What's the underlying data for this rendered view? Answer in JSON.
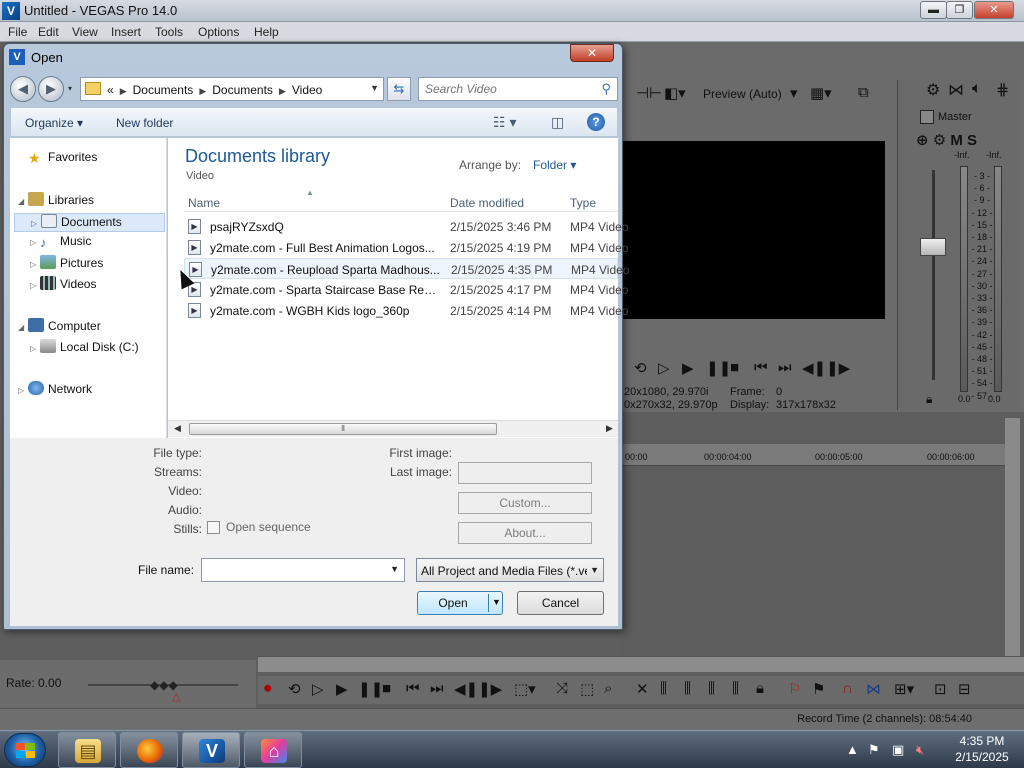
{
  "app": {
    "title": "Untitled - VEGAS Pro 14.0",
    "logo": "V",
    "window_controls": {
      "minimize": "▬",
      "maximize": "❐",
      "close": "✕"
    },
    "menu": [
      "File",
      "Edit",
      "View",
      "Insert",
      "Tools",
      "Options",
      "Help"
    ],
    "preview": {
      "mode_label": "Preview (Auto)",
      "info_line1": "20x1080, 29.970i",
      "info_line2": "0x270x32, 29.970p",
      "frame_label": "Frame:",
      "frame_value": "0",
      "display_label": "Display:",
      "display_value": "317x178x32"
    },
    "master": {
      "title": "Master",
      "inf_left": "-Inf.",
      "inf_right": "-Inf.",
      "scale": [
        "3",
        "6",
        "9",
        "12",
        "15",
        "18",
        "21",
        "24",
        "27",
        "30",
        "33",
        "36",
        "39",
        "42",
        "45",
        "48",
        "51",
        "54",
        "57"
      ],
      "zero_left": "0.0",
      "zero_right": "0.0"
    },
    "timeline_ruler": [
      "00:00",
      "00:00:04:00",
      "00:00:05:00",
      "00:00:06:00"
    ],
    "rate_label": "Rate: 0.00",
    "record_time": "Record Time (2 channels): 08:54:40"
  },
  "dialog": {
    "title": "Open",
    "close_label": "✕",
    "address": {
      "prefix": "«",
      "crumbs": [
        "Documents",
        "Documents",
        "Video"
      ]
    },
    "search_placeholder": "Search Video",
    "commands": {
      "organize": "Organize ▾",
      "new_folder": "New folder",
      "help": "?"
    },
    "nav": {
      "favorites": "Favorites",
      "libraries": "Libraries",
      "documents": "Documents",
      "music": "Music",
      "pictures": "Pictures",
      "videos": "Videos",
      "computer": "Computer",
      "local_disk": "Local Disk (C:)",
      "network": "Network"
    },
    "library": {
      "title": "Documents library",
      "subtitle": "Video",
      "arrange_label": "Arrange by:",
      "arrange_value": "Folder ▾"
    },
    "columns": {
      "name": "Name",
      "date": "Date modified",
      "type": "Type"
    },
    "files": [
      {
        "name": "psajRYZsxdQ",
        "date": "2/15/2025 3:46 PM",
        "type": "MP4 Video"
      },
      {
        "name": "y2mate.com - Full Best Animation Logos...",
        "date": "2/15/2025 4:19 PM",
        "type": "MP4 Video"
      },
      {
        "name": "y2mate.com - Reupload Sparta Madhous...",
        "date": "2/15/2025 4:35 PM",
        "type": "MP4 Video"
      },
      {
        "name": "y2mate.com - Sparta Staircase Base Reup...",
        "date": "2/15/2025 4:17 PM",
        "type": "MP4 Video"
      },
      {
        "name": "y2mate.com - WGBH Kids logo_360p",
        "date": "2/15/2025 4:14 PM",
        "type": "MP4 Video"
      }
    ],
    "details": {
      "file_type": "File type:",
      "streams": "Streams:",
      "video": "Video:",
      "audio": "Audio:",
      "stills": "Stills:",
      "open_sequence": "Open sequence",
      "first_image": "First image:",
      "last_image": "Last image:",
      "custom": "Custom...",
      "about": "About..."
    },
    "file_name_label": "File name:",
    "file_name_value": "",
    "file_type_filter": "All Project and Media Files (*.veg;*.vf",
    "open_label": "Open",
    "cancel_label": "Cancel"
  },
  "taskbar": {
    "clock_time": "4:35 PM",
    "clock_date": "2/15/2025",
    "apps": [
      "explorer-icon",
      "firefox-icon",
      "vegas-icon",
      "paint-icon"
    ]
  }
}
